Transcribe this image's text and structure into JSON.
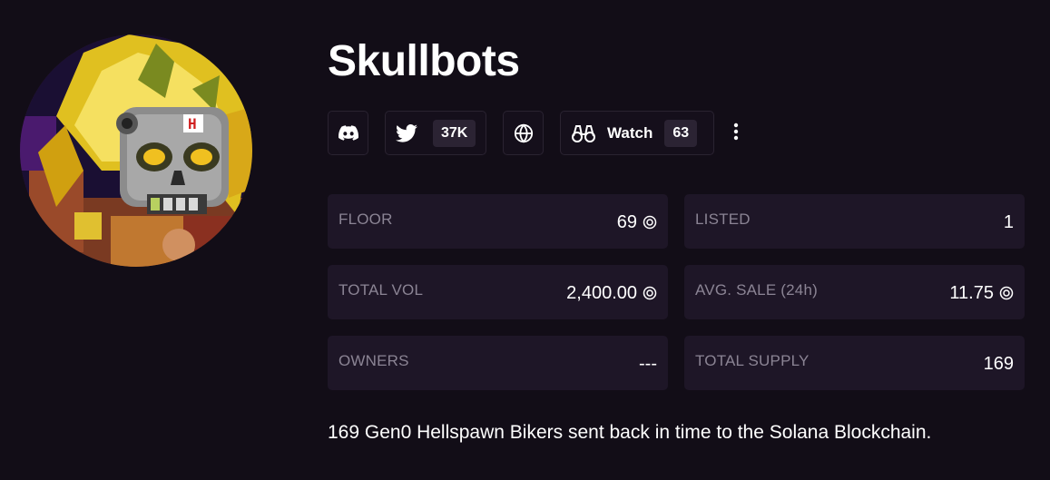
{
  "collection": {
    "name": "Skullbots",
    "description": "169 Gen0 Hellspawn Bikers sent back in time to the Solana Blockchain."
  },
  "social": {
    "discord_icon": "discord-icon",
    "twitter_icon": "twitter-icon",
    "twitter_followers": "37K",
    "website_icon": "globe-icon",
    "watch_icon": "binoculars-icon",
    "watch_label": "Watch",
    "watch_count": "63",
    "more_icon": "more-vertical-icon"
  },
  "stats": {
    "floor_label": "FLOOR",
    "floor_value": "69",
    "listed_label": "LISTED",
    "listed_value": "1",
    "total_vol_label": "TOTAL VOL",
    "total_vol_value": "2,400.00",
    "avg_sale_label": "AVG. SALE (24h)",
    "avg_sale_value": "11.75",
    "owners_label": "OWNERS",
    "owners_value": "---",
    "total_supply_label": "TOTAL SUPPLY",
    "total_supply_value": "169",
    "currency_icon": "sol-coin-icon"
  },
  "colors": {
    "background": "#120d17",
    "card": "#1e1627",
    "label": "#8b8494",
    "badge": "#2b2333"
  }
}
